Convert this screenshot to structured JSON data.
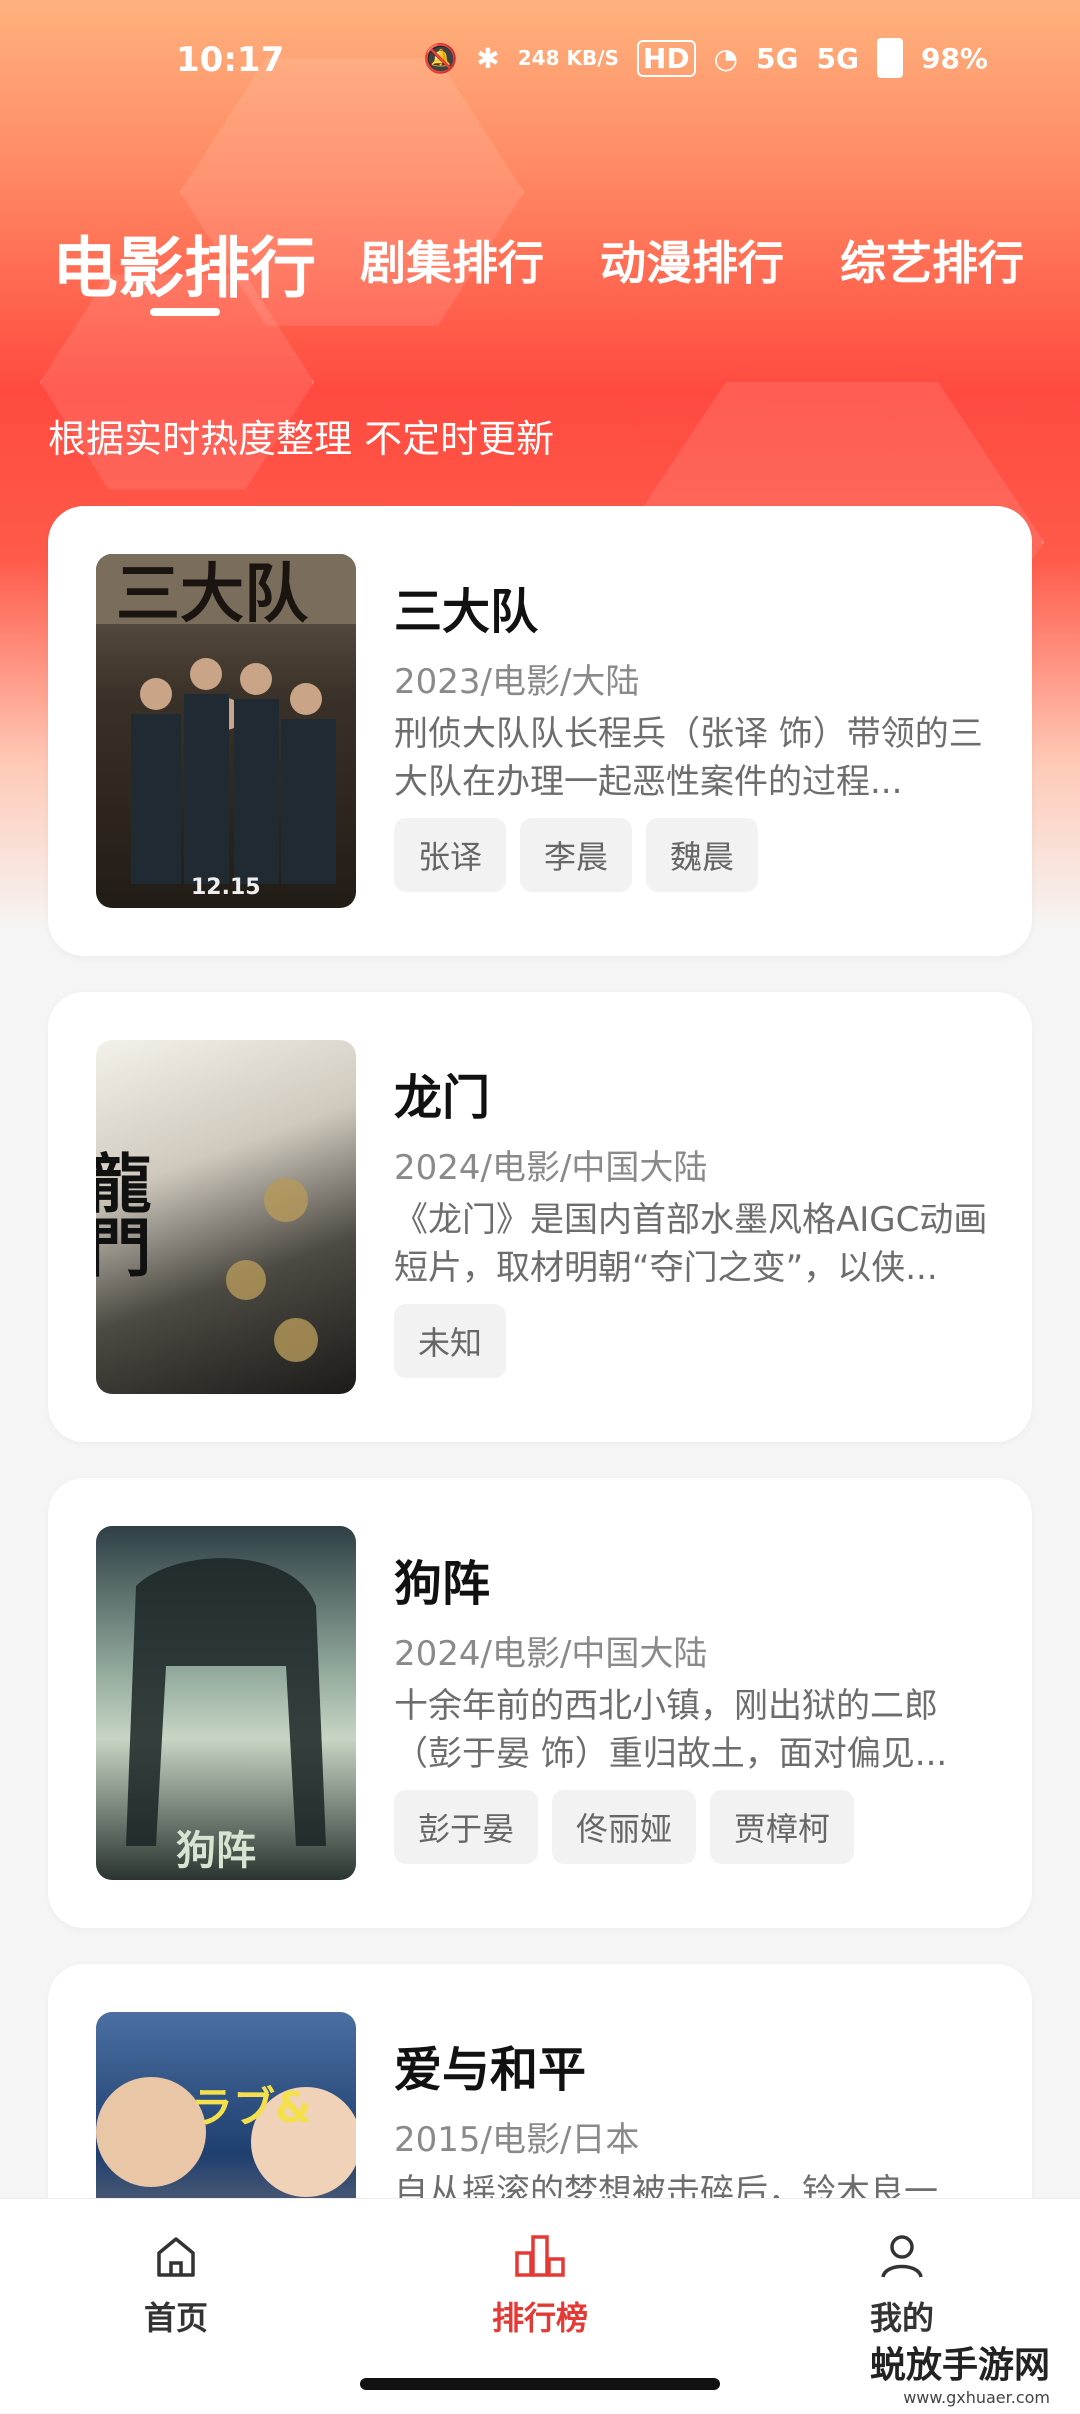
{
  "status_bar": {
    "time": "10:17",
    "net_speed": "248 KB/S",
    "hd": "HD",
    "signal1": "5G",
    "signal2": "5G",
    "battery": "98%"
  },
  "tabs": [
    {
      "label": "电影排行",
      "active": true
    },
    {
      "label": "剧集排行",
      "active": false
    },
    {
      "label": "动漫排行",
      "active": false
    },
    {
      "label": "综艺排行",
      "active": false
    }
  ],
  "subtitle": "根据实时热度整理 不定时更新",
  "movies": [
    {
      "title": "三大队",
      "meta": "2023/电影/大陆",
      "desc": "刑侦大队队长程兵（张译 饰）带领的三大队在办理一起恶性案件的过程...",
      "tags": [
        "张译",
        "李晨",
        "魏晨"
      ],
      "poster_text": "12.15"
    },
    {
      "title": "龙门",
      "meta": "2024/电影/中国大陆",
      "desc": "《龙门》是国内首部水墨风格AIGC动画短片，取材明朝“夺门之变”，以侠...",
      "tags": [
        "未知"
      ],
      "poster_text": "龍門"
    },
    {
      "title": "狗阵",
      "meta": "2024/电影/中国大陆",
      "desc": "十余年前的西北小镇，刚出狱的二郎（彭于晏 饰）重归故土，面对偏见...",
      "tags": [
        "彭于晏",
        "佟丽娅",
        "贾樟柯"
      ],
      "poster_text": "狗阵"
    },
    {
      "title": "爱与和平",
      "meta": "2015/电影/日本",
      "desc": "自从摇滚的梦想被击碎后，铃木良一...",
      "tags": [],
      "poster_text": "ラブ&"
    }
  ],
  "bottom_nav": [
    {
      "label": "首页",
      "icon": "home-icon",
      "active": false
    },
    {
      "label": "排行榜",
      "icon": "ranking-icon",
      "active": true
    },
    {
      "label": "我的",
      "icon": "profile-icon",
      "active": false
    }
  ],
  "watermark": {
    "text": "蜕放手游网",
    "url": "www.gxhuaer.com"
  },
  "colors": {
    "accent": "#e53935",
    "header_top": "#ffb27d",
    "header_mid": "#ff4a40"
  }
}
